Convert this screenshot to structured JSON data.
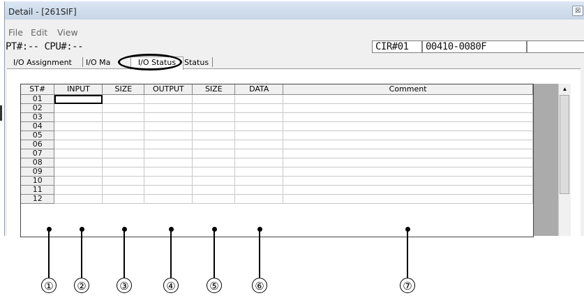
{
  "window": {
    "title": "Detail - [261SIF]",
    "close_glyph": "☒"
  },
  "menu": [
    "File",
    "Edit",
    "View"
  ],
  "info": {
    "pt_cpu": "PT#:-- CPU#:--",
    "cir": "CIR#01",
    "code": "00410-0080F",
    "extra": ""
  },
  "tabs": {
    "t1": "I/O Assignment",
    "t2": "I/O Ma",
    "active": "I/O Status",
    "t4": "Status"
  },
  "table": {
    "columns": [
      "ST#",
      "INPUT",
      "SIZE",
      "OUTPUT",
      "SIZE",
      "DATA",
      "Comment"
    ],
    "rows": [
      "01",
      "02",
      "03",
      "04",
      "05",
      "06",
      "07",
      "08",
      "09",
      "10",
      "11",
      "12"
    ]
  },
  "scrollbar": {
    "up_glyph": "▲",
    "position": 0.0
  },
  "callouts": [
    "①",
    "②",
    "③",
    "④",
    "⑤",
    "⑥",
    "⑦"
  ]
}
